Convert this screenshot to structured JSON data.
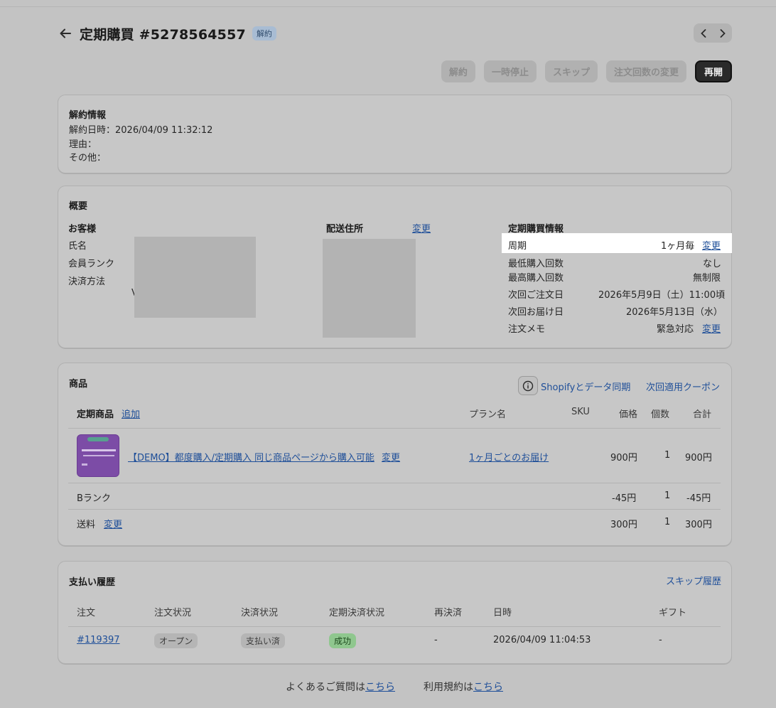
{
  "header": {
    "title": "定期購買 #5278564557",
    "status_badge": "解約"
  },
  "actions": {
    "cancel": "解約",
    "pause": "一時停止",
    "skip": "スキップ",
    "change_count": "注文回数の変更",
    "resume": "再開"
  },
  "cancellation": {
    "title": "解約情報",
    "datetime": "解約日時：2026/04/09 11:32:12",
    "reason": "理由：",
    "other": "その他："
  },
  "overview": {
    "title": "概要",
    "customer": {
      "heading": "お客様",
      "name_label": "氏名",
      "rank_label": "会員ランク",
      "payment_label": "決済方法",
      "payment_fragment": "V"
    },
    "shipping": {
      "heading": "配送住所",
      "change": "変更"
    },
    "subscription": {
      "heading": "定期購買情報",
      "cycle_label": "周期",
      "cycle_value": "1ヶ月毎",
      "cycle_change": "変更",
      "min_label": "最低購入回数",
      "min_value": "なし",
      "max_label": "最高購入回数",
      "max_value": "無制限",
      "next_order_label": "次回ご注文日",
      "next_order_value": "2026年5月9日（土）11:00頃",
      "next_delivery_label": "次回お届け日",
      "next_delivery_value": "2026年5月13日（水）",
      "memo_label": "注文メモ",
      "memo_value": "緊急対応",
      "memo_change": "変更"
    }
  },
  "products": {
    "title": "商品",
    "sync_label": "Shopifyとデータ同期",
    "coupon_label": "次回適用クーポン",
    "headers": {
      "item": "定期商品",
      "add": "追加",
      "plan": "プラン名",
      "sku": "SKU",
      "price": "価格",
      "qty": "個数",
      "total": "合計"
    },
    "item": {
      "name": "【DEMO】都度購入/定期購入 同じ商品ページから購入可能",
      "change": "変更",
      "plan": "1ヶ月ごとのお届け",
      "price": "900円",
      "qty": "1",
      "total": "900円"
    },
    "discount": {
      "label": "Bランク",
      "price": "-45円",
      "qty": "1",
      "total": "-45円"
    },
    "shipping": {
      "label": "送料",
      "change": "変更",
      "price": "300円",
      "qty": "1",
      "total": "300円"
    }
  },
  "payments": {
    "title": "支払い履歴",
    "skip_history": "スキップ履歴",
    "headers": {
      "order": "注文",
      "order_status": "注文状況",
      "payment_status": "決済状況",
      "recurring_status": "定期決済状況",
      "retry": "再決済",
      "date": "日時",
      "gift": "ギフト"
    },
    "row": {
      "order": "#119397",
      "order_status": "オープン",
      "payment_status": "支払い済",
      "recurring_status": "成功",
      "retry": "-",
      "date": "2026/04/09 11:04:53",
      "gift": "-"
    }
  },
  "footer": {
    "faq_prefix": "よくあるご質問は",
    "faq_link": "こちら",
    "terms_prefix": "利用規約は",
    "terms_link": "こちら"
  },
  "colors": {
    "overlay": "#c3c3c3",
    "link": "#1f4f99",
    "primary_button": "#2a2a2a",
    "success": "#8fc78e"
  }
}
